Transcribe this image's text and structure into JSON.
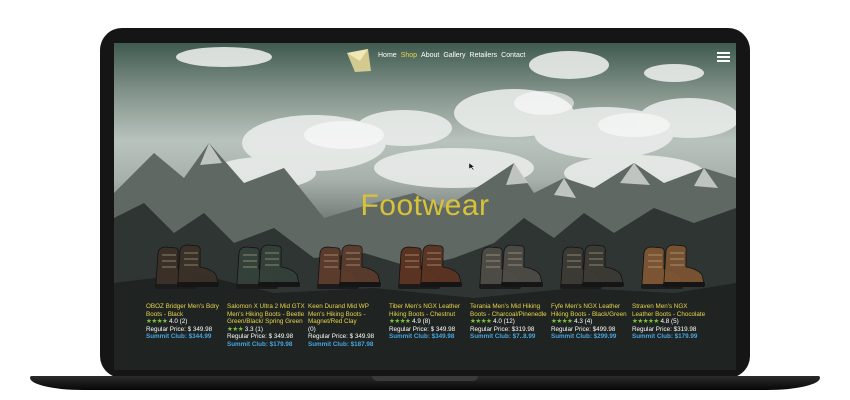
{
  "nav": {
    "items": [
      {
        "label": "Home",
        "active": false
      },
      {
        "label": "Shop",
        "active": true
      },
      {
        "label": "About",
        "active": false
      },
      {
        "label": "Gallery",
        "active": false
      },
      {
        "label": "Retailers",
        "active": false
      },
      {
        "label": "Contact",
        "active": false
      }
    ]
  },
  "page": {
    "title": "Footwear"
  },
  "colors": {
    "accent": "#e8d44a",
    "stars": "#7ec23f",
    "club_price": "#47a5e0"
  },
  "products": [
    {
      "name": "OBOZ Bridger Men's Bdry Boots - Black",
      "stars": "★★★★",
      "rating": "4.0 (2)",
      "regular": "Regular Price: $ 349.98",
      "club": "Summit Club: $344.99",
      "boot_color": "#3a3028"
    },
    {
      "name": "Salomon X Ultra 2 Mid GTX Men's Hiking Boots - Beetle Green/Black/ Spring Green",
      "stars": "★★★",
      "rating": "3.3 (1)",
      "regular": "Regular Price: $ 349.98",
      "club": "Summit Club: $179.98",
      "boot_color": "#34413a"
    },
    {
      "name": "Keen Durand Mid WP Men's Hiking Boots - Magnet/Red Clay",
      "stars": "",
      "rating": "(0)",
      "regular": "Regular Price: $ 349.98",
      "club": "Summit Club: $187.98",
      "boot_color": "#5a3b2c"
    },
    {
      "name": "Tiber Men's NGX Leather Hiking Boots - Chestnut",
      "stars": "★★★★",
      "rating": "4.9 (8)",
      "regular": "Regular Price: $ 349.98",
      "club": "Summit Club: $349.98",
      "boot_color": "#5b3322"
    },
    {
      "name": "Terania Men's Mid Hiking Boots - Charcoal/Pinenedle",
      "stars": "★★★★",
      "rating": "4.0 (12)",
      "regular": "Regular Price: $319.98",
      "club": "Summit Club: $7..8.99",
      "boot_color": "#4d4b45"
    },
    {
      "name": "Fyfe Men's NGX Leather Hiking Boots - Black/Green",
      "stars": "★★★★",
      "rating": "4.3 (4)",
      "regular": "Regular Price: $499.98",
      "club": "Summit Club: $299.99",
      "boot_color": "#3b3a34"
    },
    {
      "name": "Straven Men's NGX Leather Boots - Chocolate",
      "stars": "★★★★★",
      "rating": "4.8 (5)",
      "regular": "Regular Price: $319.98",
      "club": "Summit Club: $179.99",
      "boot_color": "#7a5433"
    }
  ]
}
